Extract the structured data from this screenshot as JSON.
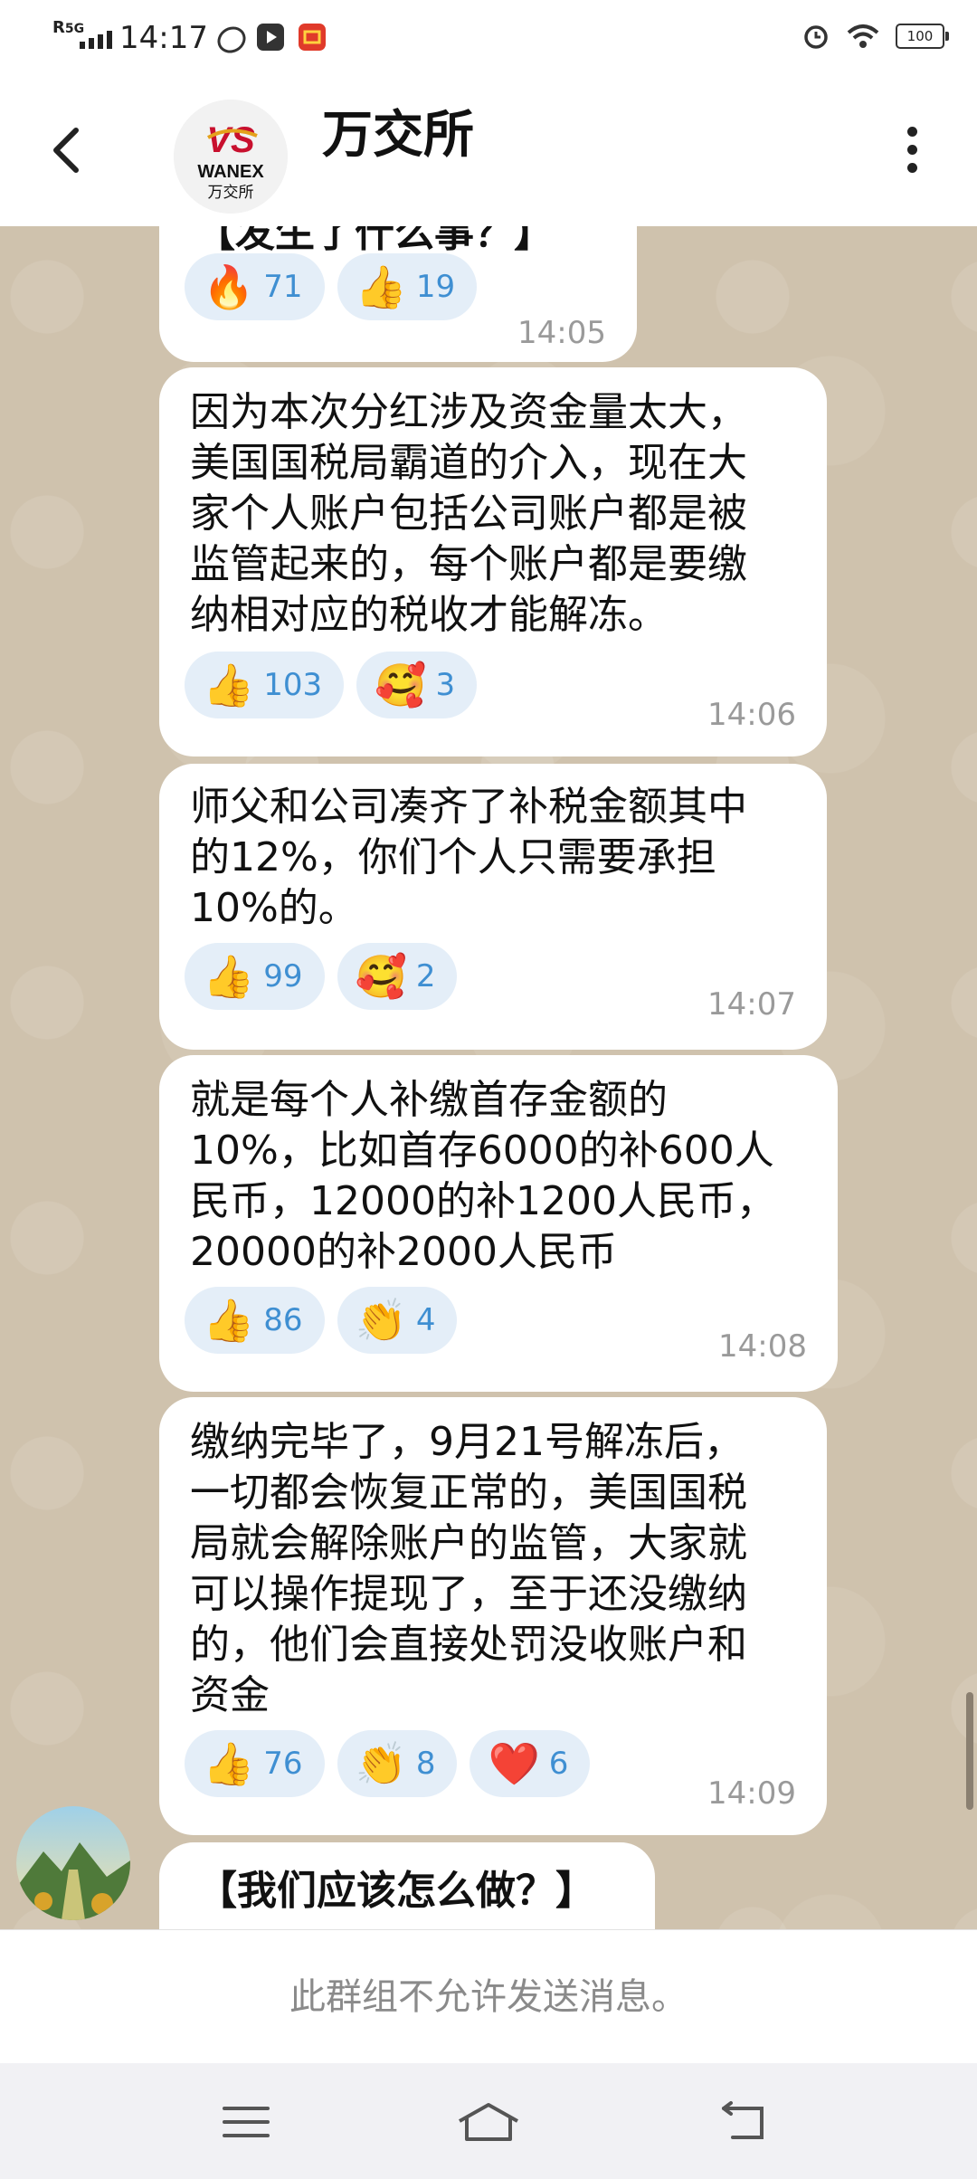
{
  "status_bar": {
    "network": "5G",
    "roaming": "R",
    "time": "14:17",
    "battery": "100"
  },
  "header": {
    "title": "万交所",
    "avatar_brand": "VS",
    "avatar_name": "WANEX",
    "avatar_subtitle": "万交所"
  },
  "messages": [
    {
      "text": "【发生了什么事？】",
      "time": "14:05",
      "reactions": [
        {
          "emoji": "🔥",
          "count": "71"
        },
        {
          "emoji": "👍",
          "count": "19"
        }
      ]
    },
    {
      "text": "因为本次分红涉及资金量太大，\n美国国税局霸道的介入，现在大\n家个人账户包括公司账户都是被\n监管起来的，每个账户都是要缴\n纳相对应的税收才能解冻。",
      "time": "14:06",
      "reactions": [
        {
          "emoji": "👍",
          "count": "103"
        },
        {
          "emoji": "🥰",
          "count": "3"
        }
      ]
    },
    {
      "text": "师父和公司凑齐了补税金额其中\n的12%，你们个人只需要承担\n10%的。",
      "time": "14:07",
      "reactions": [
        {
          "emoji": "👍",
          "count": "99"
        },
        {
          "emoji": "🥰",
          "count": "2"
        }
      ]
    },
    {
      "text": "就是每个人补缴首存金额的\n10%，比如首存6000的补600人\n民币，12000的补1200人民币，\n20000的补2000人民币",
      "time": "14:08",
      "reactions": [
        {
          "emoji": "👍",
          "count": "86"
        },
        {
          "emoji": "👏",
          "count": "4"
        }
      ]
    },
    {
      "text": "缴纳完毕了，9月21号解冻后，\n一切都会恢复正常的，美国国税\n局就会解除账户的监管，大家就\n可以操作提现了，至于还没缴纳\n的，他们会直接处罚没收账户和\n资金",
      "time": "14:09",
      "reactions": [
        {
          "emoji": "👍",
          "count": "76"
        },
        {
          "emoji": "👏",
          "count": "8"
        },
        {
          "emoji": "❤️",
          "count": "6"
        }
      ]
    },
    {
      "text": "【我们应该怎么做？】"
    }
  ],
  "footer": {
    "notice": "此群组不允许发送消息。"
  },
  "colors": {
    "chat_bg": "#cfc2ad",
    "bubble": "#ffffff",
    "reaction_chip": "#e4eef8",
    "reaction_count": "#3f8fd2",
    "brand_red": "#c8102e"
  }
}
